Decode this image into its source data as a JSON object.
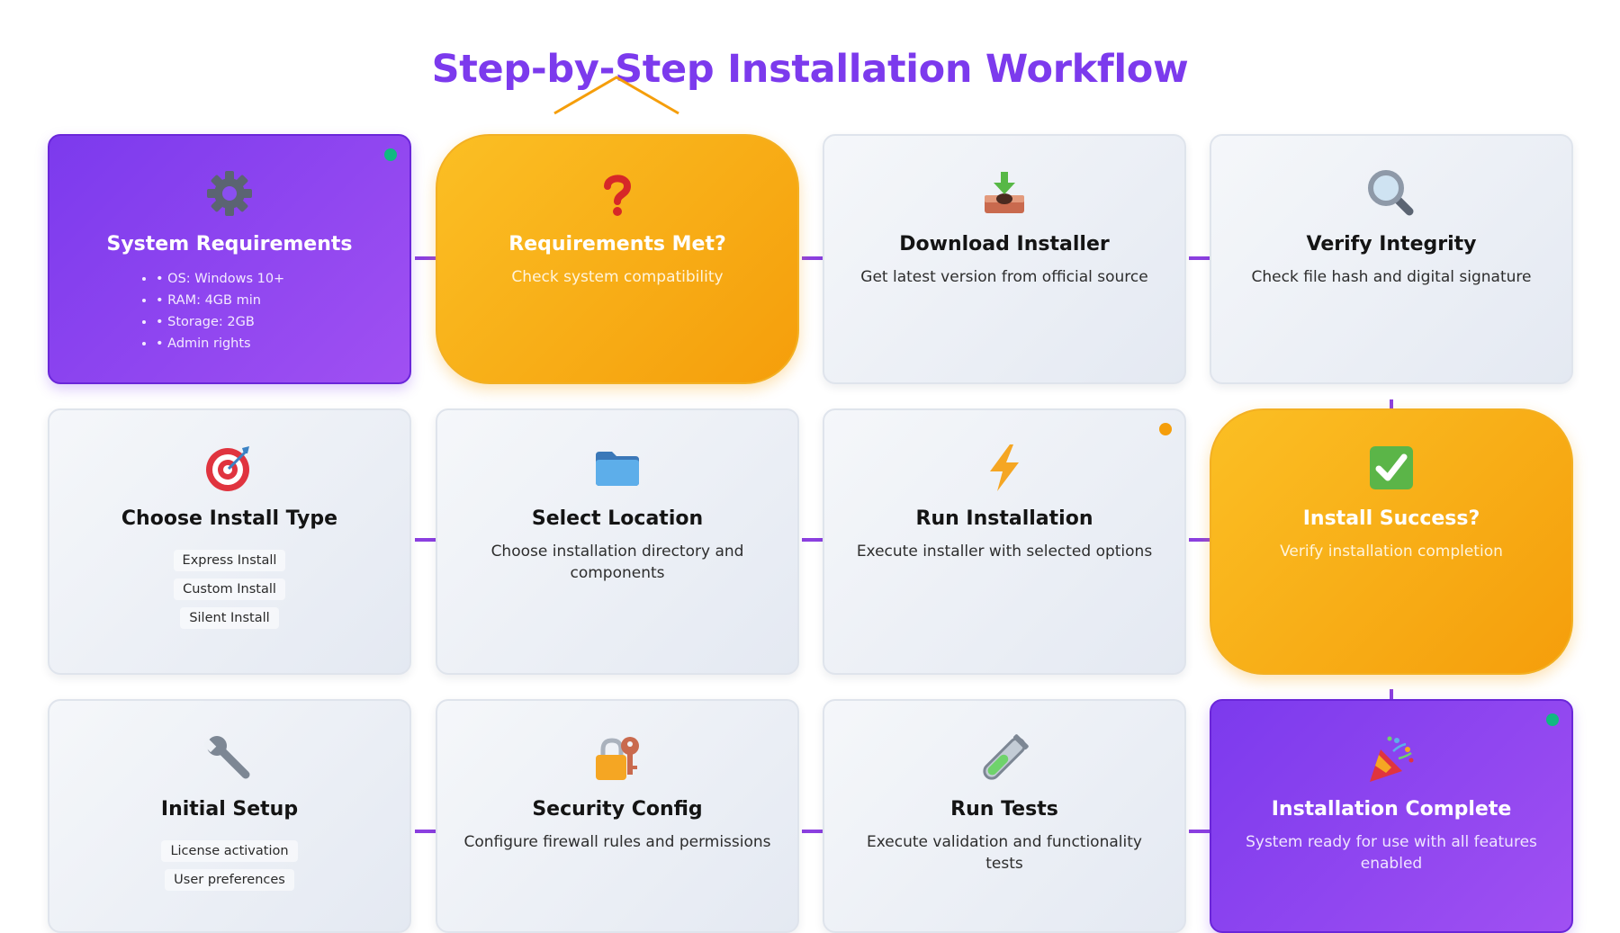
{
  "title": "Step-by-Step Installation Workflow",
  "colors": {
    "accent_purple": "#7c3aed",
    "decision_orange": "#f59e0b",
    "status_green": "#10b981",
    "status_orange": "#f59e0b",
    "connector": "#8b3fe0"
  },
  "steps": [
    {
      "title": "System Requirements",
      "style": "purple",
      "icon": "gear-icon",
      "status_dot": "green",
      "list": [
        "• OS: Windows 10+",
        "• RAM: 4GB min",
        "• Storage: 2GB",
        "• Admin rights"
      ]
    },
    {
      "title": "Requirements Met?",
      "style": "decision",
      "icon": "question-mark-icon",
      "description": "Check system compatibility"
    },
    {
      "title": "Download Installer",
      "style": "plain",
      "icon": "download-inbox-icon",
      "description": "Get latest version from official source"
    },
    {
      "title": "Verify Integrity",
      "style": "plain",
      "icon": "magnifier-icon",
      "description": "Check file hash and digital signature"
    },
    {
      "title": "Choose Install Type",
      "style": "plain",
      "icon": "target-icon",
      "options": [
        "Express Install",
        "Custom Install",
        "Silent Install"
      ]
    },
    {
      "title": "Select Location",
      "style": "plain",
      "icon": "folder-icon",
      "description": "Choose installation directory and components"
    },
    {
      "title": "Run Installation",
      "style": "plain",
      "icon": "lightning-icon",
      "status_dot": "orange",
      "description": "Execute installer with selected options"
    },
    {
      "title": "Install Success?",
      "style": "decision",
      "icon": "checkmark-icon",
      "description": "Verify installation completion"
    },
    {
      "title": "Initial Setup",
      "style": "plain",
      "icon": "wrench-icon",
      "options": [
        "License activation",
        "User preferences"
      ]
    },
    {
      "title": "Security Config",
      "style": "plain",
      "icon": "lock-key-icon",
      "description": "Configure firewall rules and permissions"
    },
    {
      "title": "Run Tests",
      "style": "plain",
      "icon": "test-tube-icon",
      "description": "Execute validation and functionality tests"
    },
    {
      "title": "Installation Complete",
      "style": "purple",
      "icon": "party-popper-icon",
      "status_dot": "green",
      "description": "System ready for use with all features enabled"
    }
  ]
}
